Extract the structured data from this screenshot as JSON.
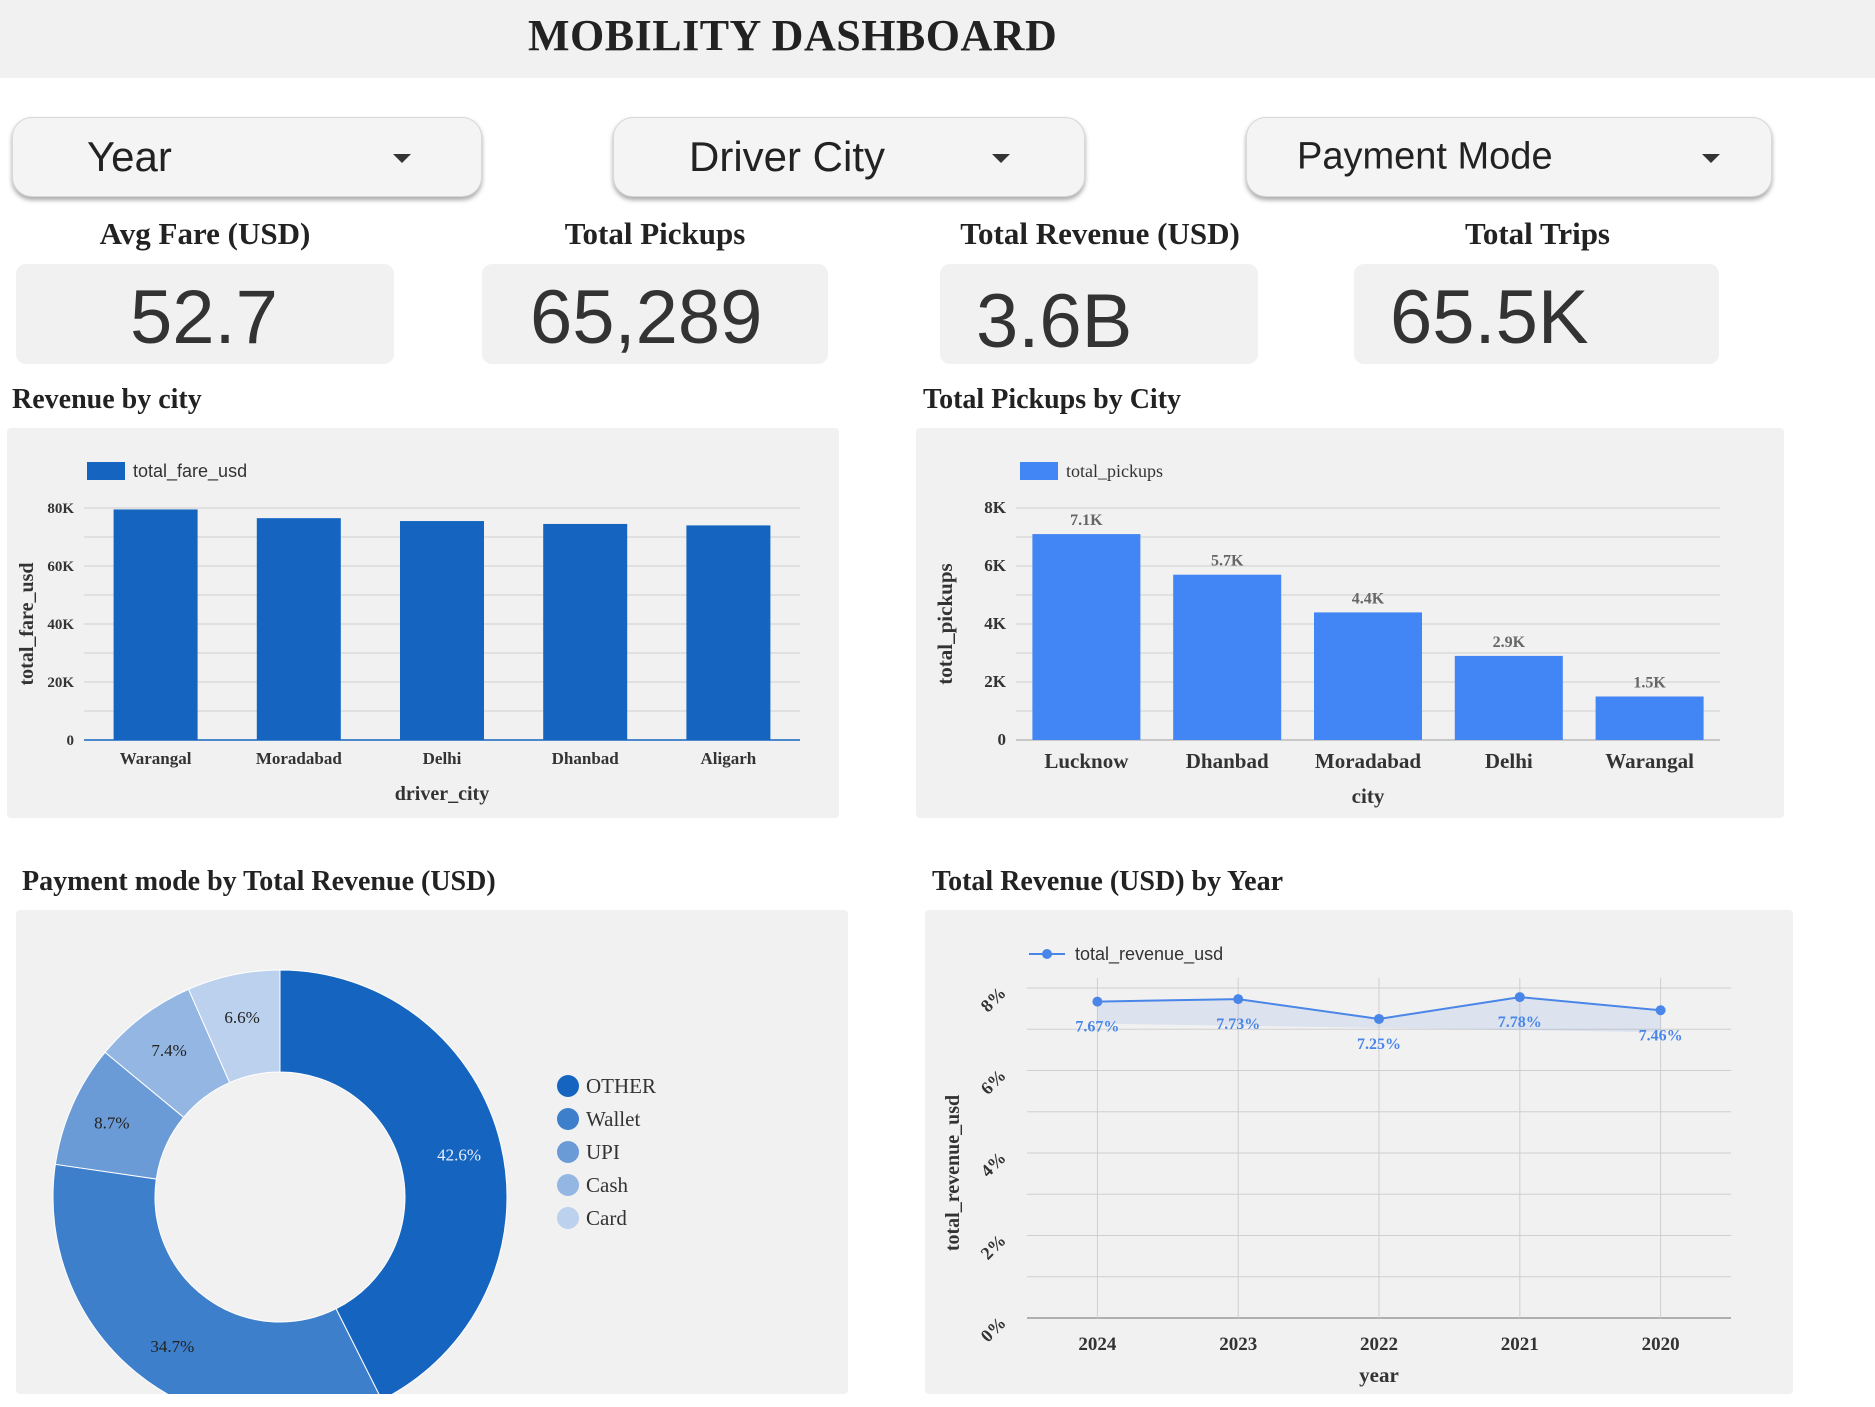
{
  "header": {
    "title": "MOBILITY DASHBOARD"
  },
  "filters": [
    {
      "label": "Year"
    },
    {
      "label": "Driver City"
    },
    {
      "label": "Payment Mode"
    }
  ],
  "kpis": [
    {
      "title": "Avg Fare (USD)",
      "value": "52.7"
    },
    {
      "title": "Total Pickups",
      "value": "65,289"
    },
    {
      "title": "Total Revenue (USD)",
      "value": "3.6B"
    },
    {
      "title": "Total Trips",
      "value": "65.5K"
    }
  ],
  "colors": {
    "dark_blue": "#1565c0",
    "bright_blue": "#4285f4",
    "line_blue": "#4a86e8",
    "panel_bg": "#f1f1f1"
  },
  "chart_data": [
    {
      "type": "bar",
      "title": "Revenue by city",
      "categories": [
        "Warangal",
        "Moradabad",
        "Delhi",
        "Dhanbad",
        "Aligarh"
      ],
      "series": [
        {
          "name": "total_fare_usd",
          "values": [
            79500,
            76500,
            75500,
            74500,
            74000
          ]
        }
      ],
      "xlabel": "driver_city",
      "ylabel": "total_fare_usd",
      "ylim": [
        0,
        80000
      ],
      "yticks": [
        "0",
        "20K",
        "40K",
        "60K",
        "80K"
      ],
      "grid": true,
      "legend": "top-left"
    },
    {
      "type": "bar",
      "title": "Total Pickups by City",
      "categories": [
        "Lucknow",
        "Dhanbad",
        "Moradabad",
        "Delhi",
        "Warangal"
      ],
      "series": [
        {
          "name": "total_pickups",
          "values": [
            7100,
            5700,
            4400,
            2900,
            1500
          ]
        }
      ],
      "data_labels": [
        "7.1K",
        "5.7K",
        "4.4K",
        "2.9K",
        "1.5K"
      ],
      "xlabel": "city",
      "ylabel": "total_pickups",
      "ylim": [
        0,
        8000
      ],
      "yticks": [
        "0",
        "2K",
        "4K",
        "6K",
        "8K"
      ],
      "grid": true,
      "legend": "top-left"
    },
    {
      "type": "pie",
      "title": "Payment mode by Total Revenue (USD)",
      "labels": [
        "OTHER",
        "Wallet",
        "UPI",
        "Cash",
        "Card"
      ],
      "values": [
        42.6,
        34.7,
        8.7,
        7.4,
        6.6
      ],
      "data_labels": [
        "42.6%",
        "34.7%",
        "8.7%",
        "7.4%",
        "6.6%"
      ],
      "colors": [
        "#1565c0",
        "#3d7fcb",
        "#6b9bd6",
        "#93b6e2",
        "#bcd1ee"
      ],
      "donut": true,
      "legend": "right"
    },
    {
      "type": "line",
      "title": "Total Revenue (USD) by Year",
      "x": [
        "2024",
        "2023",
        "2022",
        "2021",
        "2020"
      ],
      "series": [
        {
          "name": "total_revenue_usd",
          "values": [
            7.67,
            7.73,
            7.25,
            7.78,
            7.46
          ]
        }
      ],
      "data_labels": [
        "7.67%",
        "7.73%",
        "7.25%",
        "7.78%",
        "7.46%"
      ],
      "xlabel": "year",
      "ylabel": "total_revenue_usd",
      "ylim": [
        0,
        8
      ],
      "yticks": [
        "0%",
        "2%",
        "4%",
        "6%",
        "8%"
      ],
      "grid": true,
      "legend": "top-left"
    }
  ]
}
